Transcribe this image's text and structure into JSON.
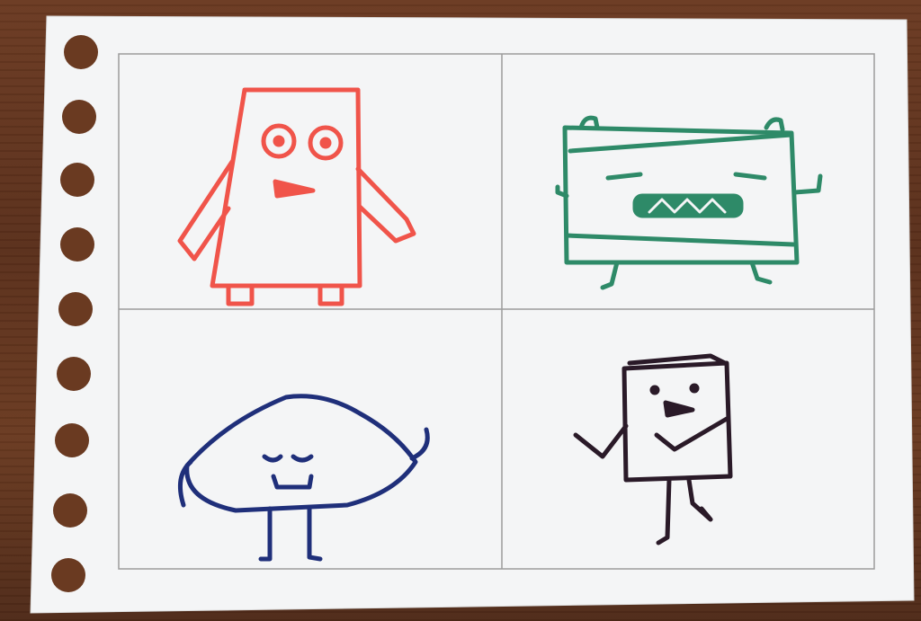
{
  "scene": {
    "background_color": "#5f331d",
    "paper_color": "#f4f5f6",
    "grid_line_color": "#9c9c9c",
    "hole_color": "#6a3a21",
    "marker_colors": {
      "red_monster": "#f0544a",
      "green_monster": "#2e8a68",
      "blue_monster": "#1f2f7a",
      "black_monster": "#2a1a28"
    },
    "drawings": [
      {
        "name": "red-rectangle-monster",
        "quadrant": "top-left"
      },
      {
        "name": "green-box-monster",
        "quadrant": "top-right"
      },
      {
        "name": "blue-dome-monster",
        "quadrant": "bottom-left"
      },
      {
        "name": "black-square-monster",
        "quadrant": "bottom-right"
      }
    ]
  }
}
